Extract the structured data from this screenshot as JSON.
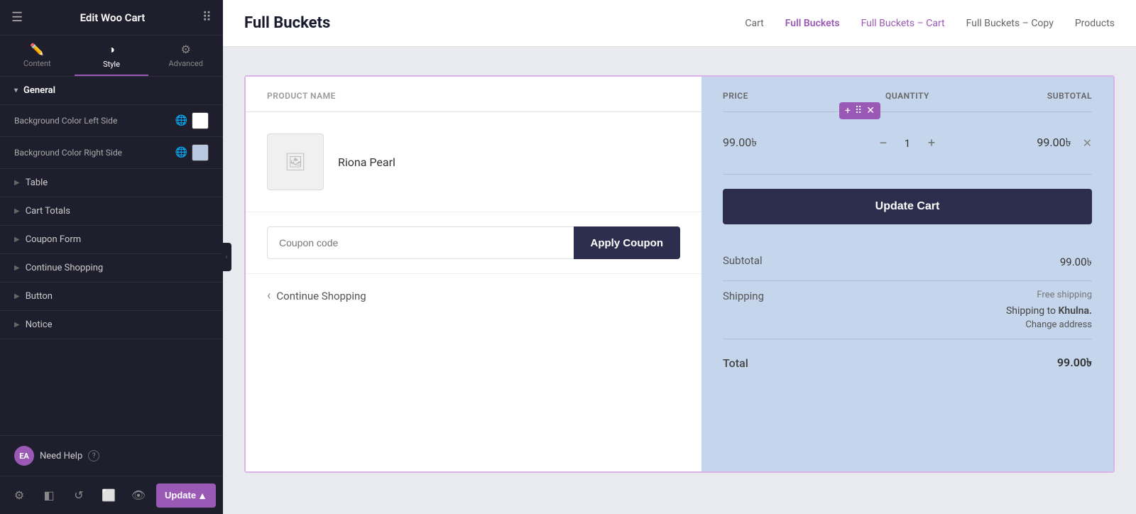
{
  "panel": {
    "title": "Edit Woo Cart",
    "tabs": [
      {
        "id": "content",
        "label": "Content",
        "icon": "✏️"
      },
      {
        "id": "style",
        "label": "Style",
        "icon": "🎨"
      },
      {
        "id": "advanced",
        "label": "Advanced",
        "icon": "⚙️"
      }
    ],
    "active_tab": "style",
    "sections": {
      "general": {
        "label": "General",
        "bg_left_label": "Background Color Left Side",
        "bg_right_label": "Background Color Right Side"
      },
      "table": {
        "label": "Table"
      },
      "cart_totals": {
        "label": "Cart Totals"
      },
      "coupon_form": {
        "label": "Coupon Form"
      },
      "continue_shopping": {
        "label": "Continue Shopping"
      },
      "button": {
        "label": "Button"
      },
      "notice": {
        "label": "Notice"
      }
    },
    "need_help": "Need Help",
    "update_btn": "Update"
  },
  "nav": {
    "page_title": "Full Buckets",
    "links": [
      {
        "label": "Cart",
        "active": false
      },
      {
        "label": "Full Buckets",
        "active": true
      },
      {
        "label": "Full Buckets – Cart",
        "active": false
      },
      {
        "label": "Full Buckets – Copy",
        "active": false
      },
      {
        "label": "Products",
        "active": false
      }
    ]
  },
  "cart": {
    "col_product": "PRODUCT NAME",
    "col_price": "PRICE",
    "col_quantity": "QUANTITY",
    "col_subtotal": "SUBTOTAL",
    "product": {
      "name": "Riona Pearl",
      "price": "99.00৳",
      "quantity": 1,
      "subtotal": "99.00৳"
    },
    "coupon_placeholder": "Coupon code",
    "apply_coupon_btn": "Apply Coupon",
    "continue_shopping": "Continue Shopping",
    "update_cart_btn": "Update Cart",
    "totals": {
      "subtotal_label": "Subtotal",
      "subtotal_value": "99.00৳",
      "shipping_label": "Shipping",
      "free_shipping": "Free shipping",
      "shipping_to": "Shipping to",
      "shipping_city": "Khulna.",
      "change_address": "Change address",
      "total_label": "Total",
      "total_value": "99.00৳"
    }
  }
}
